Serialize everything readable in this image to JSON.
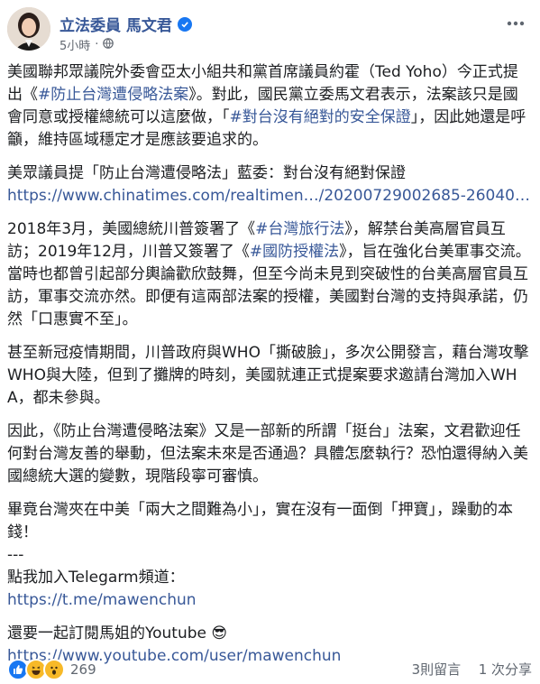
{
  "header": {
    "author": "立法委員 馬文君",
    "time": "5小時",
    "privacy_sep": "·"
  },
  "body": {
    "p1": [
      {
        "t": "美國聯邦眾議院外委會亞太小組共和黨首席議員約霍（Ted Yoho）今正式提出《"
      },
      {
        "t": "#防止台灣遭侵略法案",
        "tag": true
      },
      {
        "t": "》。對此，國民黨立委馬文君表示，法案該只是國會同意或授權總統可以這麼做，「"
      },
      {
        "t": "#對台沒有絕對的安全保證",
        "tag": true
      },
      {
        "t": "」，因此她還是呼籲，維持區域穩定才是應該要追求的。"
      }
    ],
    "p2_line1": "美眾議員提「防止台灣遭侵略法」藍委：對台沒有絕對保證",
    "p2_link": "https://www.chinatimes.com/realtimen…/20200729002685-260407…",
    "p3": [
      {
        "t": "2018年3月，美國總統川普簽署了《"
      },
      {
        "t": "#台灣旅行法",
        "tag": true
      },
      {
        "t": "》，解禁台美高層官員互訪；2019年12月，川普又簽署了《"
      },
      {
        "t": "#國防授權法",
        "tag": true
      },
      {
        "t": "》，旨在強化台美軍事交流。當時也都曾引起部分輿論歡欣鼓舞，但至今尚未見到突破性的台美高層官員互訪，軍事交流亦然。即便有這兩部法案的授權，美國對台灣的支持與承諾，仍然「口惠實不至」。"
      }
    ],
    "p4": "甚至新冠疫情期間，川普政府與WHO「撕破臉」，多次公開發言，藉台灣攻擊WHO與大陸，但到了攤牌的時刻，美國就連正式提案要求邀請台灣加入WHA，都未參與。",
    "p5": "因此，《防止台灣遭侵略法案》又是一部新的所謂「挺台」法案，文君歡迎任何對台灣友善的舉動，但法案未來是否通過？具體怎麼執行？恐怕還得納入美國總統大選的變數，現階段寧可審慎。",
    "p6": "畢竟台灣夾在中美「兩大之間難為小」，實在沒有一面倒「押寶」，躁動的本錢！",
    "sep": "---",
    "telegram_label": "點我加入Telegarm頻道：",
    "telegram_link": "https://t.me/mawenchun",
    "youtube_label": "還要一起訂閱馬姐的Youtube",
    "youtube_emoji": "😎",
    "youtube_link": "https://www.youtube.com/user/mawenchun"
  },
  "footer": {
    "reaction_count": "269",
    "comments": "3則留言",
    "shares": "1 次分享"
  },
  "colors": {
    "link": "#385898",
    "like": "#1877f2",
    "haha": "#f7b928",
    "wow": "#f7b928"
  },
  "icons": [
    "verified-icon",
    "globe-icon",
    "more-icon",
    "like-react-icon",
    "haha-react-icon",
    "wow-react-icon"
  ]
}
